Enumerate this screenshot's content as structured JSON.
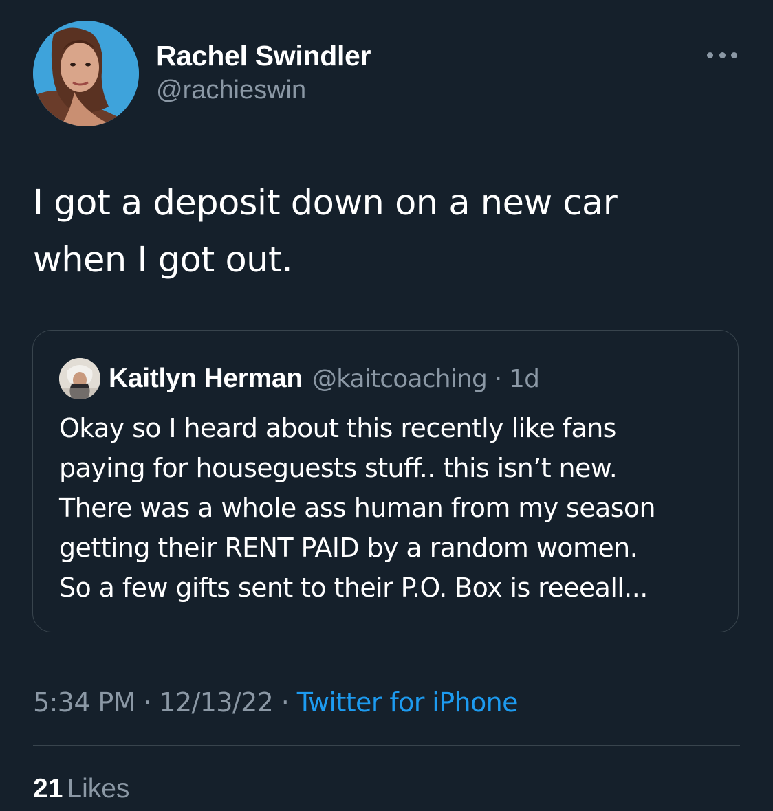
{
  "author": {
    "display_name": "Rachel Swindler",
    "handle": "@rachieswin"
  },
  "tweet": {
    "text_line1": "I got a deposit down on a new car",
    "text_line2": "when I got out."
  },
  "quoted_tweet": {
    "display_name": "Kaitlyn Herman",
    "handle": "@kaitcoaching",
    "separator": "·",
    "age": "1d",
    "lines": [
      "Okay so I heard about this recently like fans",
      "paying for houseguests stuff.. this isn’t new.",
      "There was a whole ass human from my season",
      "getting their RENT PAID by a random women.",
      "So a few gifts sent to their P.O. Box is reeeall..."
    ]
  },
  "meta": {
    "time": "5:34 PM",
    "separator": "·",
    "date": "12/13/22",
    "source": "Twitter for iPhone"
  },
  "stats": {
    "likes_count": "21",
    "likes_label": "Likes"
  },
  "icons": {
    "more": "more-horizontal-icon"
  },
  "colors": {
    "background": "#15202b",
    "primary_text": "#ffffff",
    "secondary_text": "#8b98a5",
    "link": "#1d9bf0",
    "border": "#38444d"
  }
}
